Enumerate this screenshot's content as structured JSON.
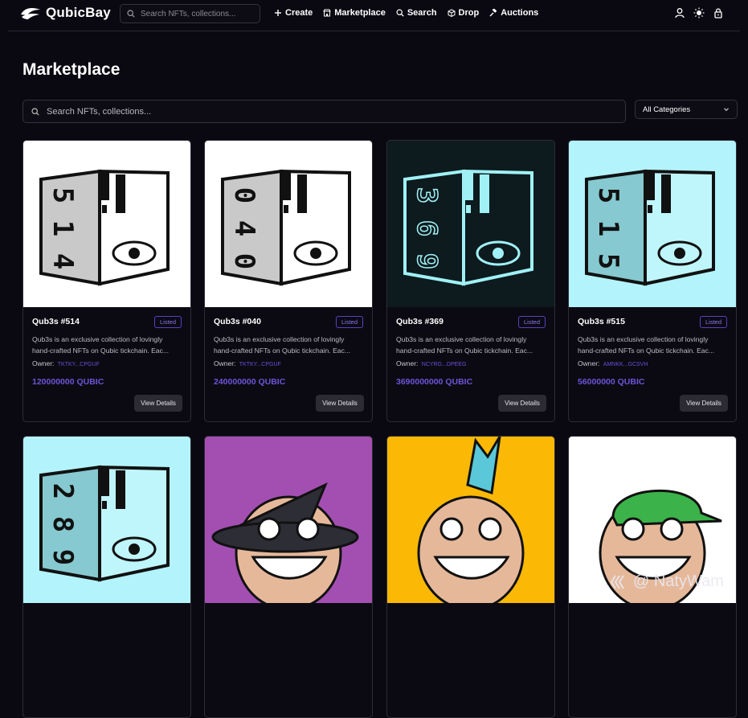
{
  "brand": {
    "name": "QubicBay"
  },
  "topbar": {
    "search_placeholder": "Search NFTs, collections...",
    "nav": [
      {
        "label": "Create",
        "icon": "plus-icon"
      },
      {
        "label": "Marketplace",
        "icon": "store-icon"
      },
      {
        "label": "Search",
        "icon": "search-icon"
      },
      {
        "label": "Drop",
        "icon": "box-icon"
      },
      {
        "label": "Auctions",
        "icon": "gavel-icon"
      }
    ],
    "icons": [
      "user-icon",
      "sun-icon",
      "lock-icon"
    ]
  },
  "page": {
    "title": "Marketplace",
    "search_placeholder": "Search NFTs, collections...",
    "category": "All Categories"
  },
  "cards": [
    {
      "title": "Qub3s #514",
      "badge": "Listed",
      "desc": "Qub3s is an exclusive collection of lovingly hand-crafted NFTs on Qubic tickchain. Eac...",
      "owner_label": "Owner:",
      "owner": "TKTKY...CPGUF",
      "price": "120000000 QUBIC",
      "button": "View Details",
      "bg": "#ffffff",
      "digits": [
        "5",
        "1",
        "4"
      ]
    },
    {
      "title": "Qub3s #040",
      "badge": "Listed",
      "desc": "Qub3s is an exclusive collection of lovingly hand-crafted NFTs on Qubic tickchain. Eac...",
      "owner_label": "Owner:",
      "owner": "TKTKY...CPGUF",
      "price": "240000000 QUBIC",
      "button": "View Details",
      "bg": "#ffffff",
      "digits": [
        "0",
        "4",
        "0"
      ]
    },
    {
      "title": "Qub3s #369",
      "badge": "Listed",
      "desc": "Qub3s is an exclusive collection of lovingly hand-crafted NFTs on Qubic tickchain. Eac...",
      "owner_label": "Owner:",
      "owner": "NCYRG...DPEEG",
      "price": "3690000000 QUBIC",
      "button": "View Details",
      "bg": "#0d1a1e",
      "digits": [
        "3",
        "6",
        "9"
      ]
    },
    {
      "title": "Qub3s #515",
      "badge": "Listed",
      "desc": "Qub3s is an exclusive collection of lovingly hand-crafted NFTs on Qubic tickchain. Eac...",
      "owner_label": "Owner:",
      "owner": "AMNKK...GCSVH",
      "price": "56000000 QUBIC",
      "button": "View Details",
      "bg": "#b3f3fb",
      "digits": [
        "5",
        "1",
        "5"
      ]
    }
  ],
  "row2_cards": [
    {
      "bg": "#b3f3fb",
      "digits": [
        "2",
        "8",
        "9"
      ]
    },
    {
      "bg": "#a34fb2"
    },
    {
      "bg": "#fbb905"
    },
    {
      "bg": "#ffffff"
    }
  ],
  "watermark": "@ NatyWam"
}
